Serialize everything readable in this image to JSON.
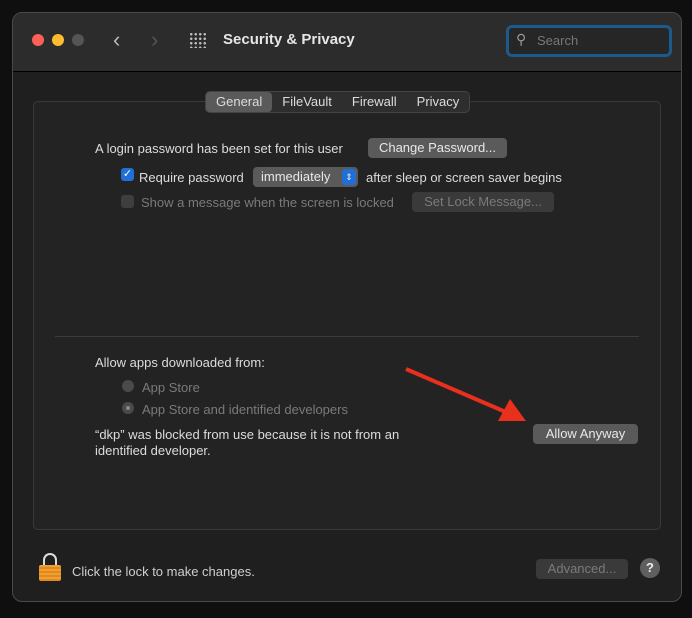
{
  "window": {
    "title": "Security & Privacy",
    "search_placeholder": "Search"
  },
  "tabs": [
    {
      "label": "General",
      "selected": true
    },
    {
      "label": "FileVault"
    },
    {
      "label": "Firewall"
    },
    {
      "label": "Privacy"
    }
  ],
  "general": {
    "login_text": "A login password has been set for this user",
    "change_password": "Change Password...",
    "require_password_label": "Require password",
    "require_password_checked": true,
    "require_password_value": "immediately",
    "after_text": "after sleep or screen saver begins",
    "show_message_label": "Show a message when the screen is locked",
    "show_message_checked": false,
    "set_lock_message": "Set Lock Message...",
    "allow_apps_label": "Allow apps downloaded from:",
    "options": [
      "App Store",
      "App Store and identified developers"
    ],
    "selected_option": "App Store and identified developers",
    "blocked_text_1": "“dkp” was blocked from use because it is not from an",
    "blocked_text_2": "identified developer.",
    "allow_anyway": "Allow Anyway"
  },
  "footer": {
    "lock_text": "Click the lock to make changes.",
    "advanced": "Advanced...",
    "help": "?"
  },
  "colors": {
    "accent": "#1f6fd6",
    "search_focus": "#1d5a8c",
    "arrow": "#e8301c"
  }
}
